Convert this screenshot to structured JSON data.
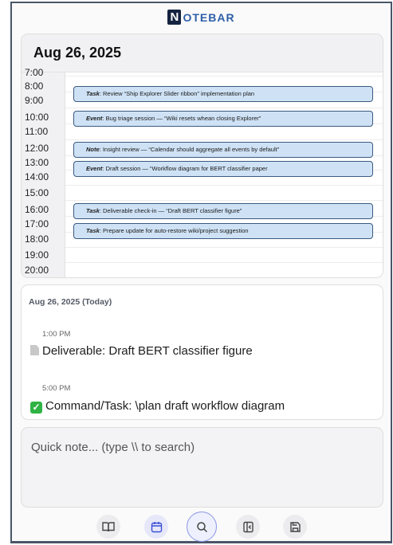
{
  "app": {
    "logo_initial": "N",
    "logo_rest": "OTEBAR"
  },
  "calendar": {
    "date_title": "Aug 26, 2025",
    "hours": [
      "7:00",
      "8:00",
      "9:00",
      "10:00",
      "11:00",
      "12:00",
      "13:00",
      "14:00",
      "15:00",
      "16:00",
      "17:00",
      "18:00",
      "19:00",
      "20:00"
    ],
    "events": [
      {
        "kind": "Task",
        "text": ": Review “Ship Explorer Slider ribbon” implementation plan"
      },
      {
        "kind": "Event",
        "text": ": Bug triage session — “Wiki resets whean closing Explorer”"
      },
      {
        "kind": "Note",
        "text": ": Insight review — “Calendar should aggregate all events by default”"
      },
      {
        "kind": "Event",
        "text": ": Draft session — “Workflow diagram for BERT classifier paper"
      },
      {
        "kind": "Task",
        "text": ": Deliverable check-in — “Draft BERT classifier figure”"
      },
      {
        "kind": "Task",
        "text": ": Prepare update for auto-restore wiki/project suggestion"
      }
    ]
  },
  "agenda": {
    "date_heading": "Aug 26, 2025 (Today)",
    "items": [
      {
        "time": "1:00 PM",
        "icon": "document-icon",
        "label": "Deliverable: Draft BERT classifier figure"
      },
      {
        "time": "5:00 PM",
        "icon": "checkmark-icon",
        "label": "Command/Task: \\plan draft workflow diagram"
      }
    ]
  },
  "quick_note": {
    "placeholder": "Quick note... (type \\\\ to search)"
  },
  "toolbar": {
    "buttons": [
      "book-icon",
      "calendar-icon",
      "search-icon",
      "panel-collapse-icon",
      "save-icon"
    ]
  },
  "colors": {
    "accent": "#2e5fa8",
    "event_fill": "#cfe2f5",
    "event_border": "#3a5a80",
    "search_ring": "#8a96e6"
  }
}
